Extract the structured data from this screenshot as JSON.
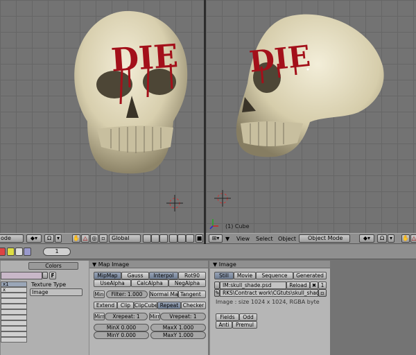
{
  "left_header": {
    "mode": "ode",
    "orientation": "Global"
  },
  "right_header": {
    "menus": [
      "View",
      "Select",
      "Object"
    ],
    "mode": "Object Mode"
  },
  "viewport_right": {
    "object_label": "(1) Cube",
    "decal_text": "DIE"
  },
  "viewport_left": {
    "decal_text": "DIE"
  },
  "toolbar": {
    "frame": "1"
  },
  "texture_panel": {
    "colors_tab": "Colors",
    "texture_type_label": "Texture Type",
    "texture_type": "Image",
    "f_button": "F",
    "list": [
      "x1",
      "x",
      ""
    ]
  },
  "map_image": {
    "title": "Map Image",
    "row1": [
      "MipMap",
      "Gauss",
      "Interpol",
      "Rot90"
    ],
    "row2": [
      "UseAlpha",
      "CalcAlpha",
      "NegAlpha"
    ],
    "min": "Min",
    "filter": "Filter: 1.000",
    "normal_map": "Normal Map",
    "tangent": "Tangent",
    "row4": [
      "Extend",
      "Clip",
      "ClipCube",
      "Repeat",
      "Checker"
    ],
    "mirr": "Mirr",
    "xrepeat": "Xrepeat: 1",
    "vrepeat": "Vrepeat: 1",
    "minx": "MinX 0.000",
    "maxx": "MaxX 1.000",
    "miny": "MinY 0.000",
    "maxy": "MaxY 1.000"
  },
  "image": {
    "title": "Image",
    "tabs": [
      "Still",
      "Movie",
      "Sequence",
      "Generated"
    ],
    "name": "IM:skull_shade.psd",
    "reload": "Reload",
    "users": "1",
    "path": "RKS\\Contract work\\CGtuts\\skull_shade.psd",
    "info": "Image : size 1024 x 1024, RGBA byte",
    "fields": "Fields",
    "odd": "Odd",
    "anti": "Anti",
    "premul": "Premul"
  },
  "colors": {
    "accent_on": "#7c889c",
    "viewport_bg": "#737373",
    "blood": "#a3101a",
    "bone": "#ddd6b8"
  }
}
